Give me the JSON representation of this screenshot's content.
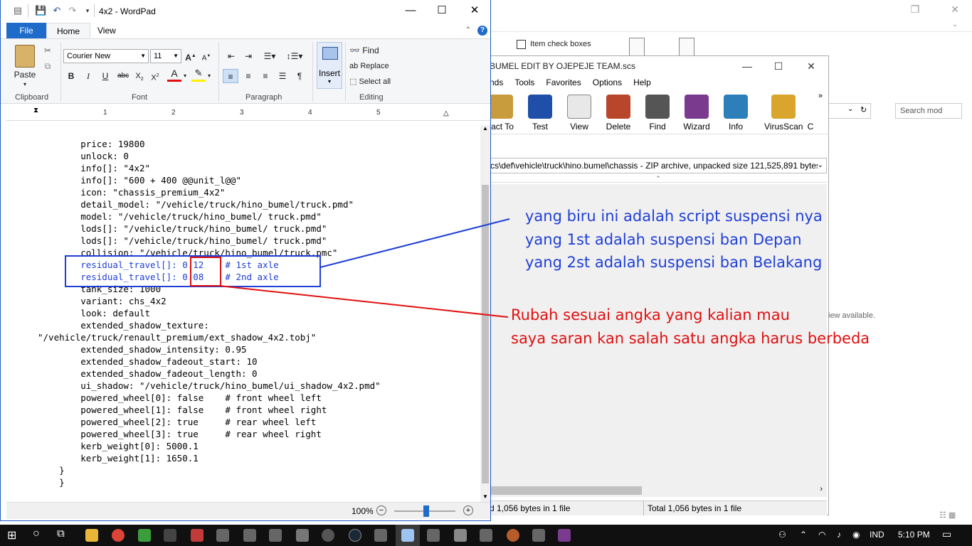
{
  "explorer": {
    "item_check_boxes": "Item check boxes",
    "search_placeholder": "Search mod",
    "preview_text": "iew available."
  },
  "archive": {
    "title": "BUMEL EDIT BY OJEPEJE TEAM.scs",
    "menu": [
      "nds",
      "Tools",
      "Favorites",
      "Options",
      "Help"
    ],
    "tools": [
      "ract To",
      "Test",
      "View",
      "Delete",
      "Find",
      "Wizard",
      "Info",
      "VirusScan",
      "C"
    ],
    "path": "cs\\def\\vehicle\\truck\\hino.bumel\\chassis - ZIP archive, unpacked size 121,525,891 bytes",
    "status_left": "d 1,056 bytes in 1 file",
    "status_right": "Total 1,056 bytes in 1 file"
  },
  "annotations": {
    "blue": [
      "yang biru ini adalah script suspensi nya",
      "yang 1st adalah suspensi ban Depan",
      "yang 2st adalah suspensi ban Belakang"
    ],
    "red": [
      "Rubah sesuai angka yang kalian mau",
      "saya saran kan salah satu angka harus berbeda"
    ],
    "colors": {
      "blue": "#1f3fd6",
      "red": "#e01010"
    }
  },
  "wordpad": {
    "title": "4x2 - WordPad",
    "tabs": {
      "file": "File",
      "home": "Home",
      "view": "View"
    },
    "clipboard": {
      "paste": "Paste",
      "label": "Clipboard"
    },
    "font": {
      "family": "Courier New",
      "size": "11",
      "label": "Font"
    },
    "paragraph": {
      "label": "Paragraph"
    },
    "insert": {
      "label": "Insert"
    },
    "editing": {
      "find": "Find",
      "replace": "Replace",
      "select_all": "Select all",
      "label": "Editing"
    },
    "ruler_numbers": [
      "1",
      "2",
      "3",
      "4",
      "5"
    ],
    "zoom": "100%",
    "zoom_level": 1.0,
    "code_lines": [
      "        price: 19800",
      "        unlock: 0",
      "        info[]: \"4x2\"",
      "        info[]: \"600 + 400 @@unit_l@@\"",
      "        icon: \"chassis_premium_4x2\"",
      "        detail_model: \"/vehicle/truck/hino_bumel/truck.pmd\"",
      "        model: \"/vehicle/truck/hino_bumel/ truck.pmd\"",
      "        lods[]: \"/vehicle/truck/hino_bumel/ truck.pmd\"",
      "        lods[]: \"/vehicle/truck/hino_bumel/ truck.pmd\"",
      "        collision: \"/vehicle/truck/hino_bumel/truck.pmc\"",
      "        residual_travel[]: 0.12    # 1st axle",
      "        residual_travel[]: 0.08    # 2nd axle",
      "        tank_size: 1000",
      "        variant: chs_4x2",
      "        look: default",
      "        extended_shadow_texture:",
      "\"/vehicle/truck/renault_premium/ext_shadow_4x2.tobj\"",
      "        extended_shadow_intensity: 0.95",
      "        extended_shadow_fadeout_start: 10",
      "        extended_shadow_fadeout_length: 0",
      "        ui_shadow: \"/vehicle/truck/hino_bumel/ui_shadow_4x2.pmd\"",
      "        powered_wheel[0]: false    # front wheel left",
      "        powered_wheel[1]: false    # front wheel right",
      "        powered_wheel[2]: true     # rear wheel left",
      "        powered_wheel[3]: true     # rear wheel right",
      "        kerb_weight[0]: 5000.1",
      "        kerb_weight[1]: 1650.1",
      "    }",
      "    }"
    ]
  },
  "taskbar": {
    "language": "IND",
    "time": "5:10 PM"
  }
}
